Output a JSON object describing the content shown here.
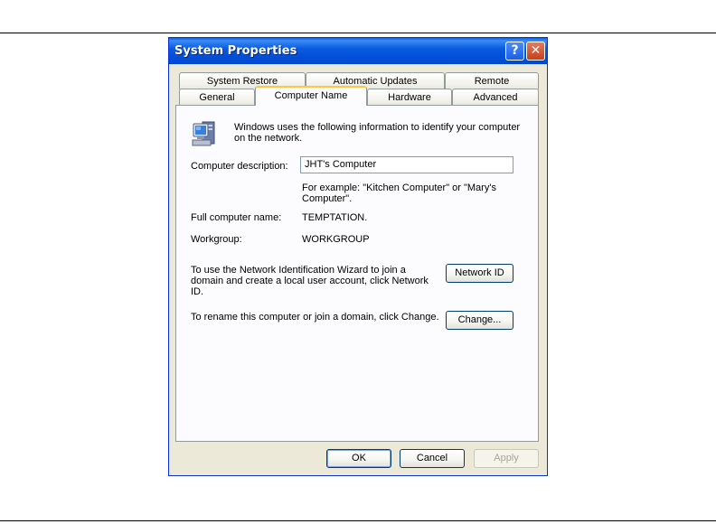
{
  "window": {
    "title": "System Properties",
    "help_glyph": "?",
    "close_glyph": "✕"
  },
  "tabs": {
    "row1": [
      "System Restore",
      "Automatic Updates",
      "Remote"
    ],
    "row2": [
      "General",
      "Computer Name",
      "Hardware",
      "Advanced"
    ],
    "active": "Computer Name"
  },
  "panel": {
    "intro": "Windows uses the following information to identify your computer on the network.",
    "description_label": "Computer description:",
    "description_value": "JHT's Computer",
    "example_text": "For example: \"Kitchen Computer\" or \"Mary's Computer\".",
    "full_name_label": "Full computer name:",
    "full_name_value": "TEMPTATION.",
    "workgroup_label": "Workgroup:",
    "workgroup_value": "WORKGROUP",
    "network_id_text": "To use the Network Identification Wizard to join a domain and create a local user account, click Network ID.",
    "network_id_button": "Network ID",
    "rename_text": "To rename this computer or join a domain, click Change.",
    "change_button": "Change..."
  },
  "footer": {
    "ok": "OK",
    "cancel": "Cancel",
    "apply": "Apply"
  },
  "colors": {
    "titlebar": "#0450d8",
    "dialog_bg": "#ece9d8",
    "active_tab_accent": "#ffc83c"
  },
  "icons": {
    "intro_icon": "computer-icon"
  }
}
